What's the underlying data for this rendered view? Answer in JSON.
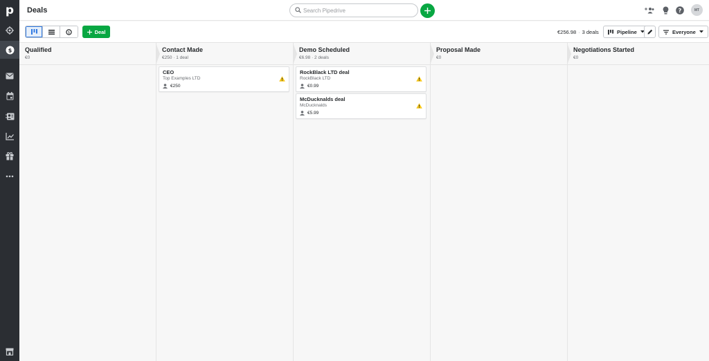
{
  "header": {
    "title": "Deals",
    "search_placeholder": "Search Pipedrive",
    "avatar_initials": "MT"
  },
  "toolbar": {
    "add_deal_label": "Deal",
    "total_value": "€256.98",
    "deal_count": "3 deals",
    "pipeline_label": "Pipeline",
    "owner_filter_label": "Everyone",
    "active_view": "pipeline"
  },
  "nav": {
    "logo": "p",
    "items": [
      "focus-icon",
      "deals-icon",
      "mail-icon",
      "calendar-icon",
      "contacts-icon",
      "insights-icon",
      "products-icon",
      "more-icon"
    ],
    "active": "deals-icon"
  },
  "stages": [
    {
      "name": "Qualified",
      "meta": "€0",
      "cards": []
    },
    {
      "name": "Contact Made",
      "meta": "€250 · 1 deal",
      "cards": [
        {
          "title": "CEO",
          "org": "Top Examples LTD",
          "value": "€250"
        }
      ]
    },
    {
      "name": "Demo Scheduled",
      "meta": "€6.98 · 2 deals",
      "cards": [
        {
          "title": "RockBlack LTD deal",
          "org": "RockBlack LTD",
          "value": "€0.99"
        },
        {
          "title": "McDucknalds deal",
          "org": "McDucknalds",
          "value": "€5.99"
        }
      ]
    },
    {
      "name": "Proposal Made",
      "meta": "€0",
      "cards": []
    },
    {
      "name": "Negotiations Started",
      "meta": "€0",
      "cards": []
    }
  ],
  "colors": {
    "accent_green": "#08a742",
    "nav_bg": "#2b2e33",
    "warning": "#f5c518",
    "active_view": "#317ae2"
  }
}
